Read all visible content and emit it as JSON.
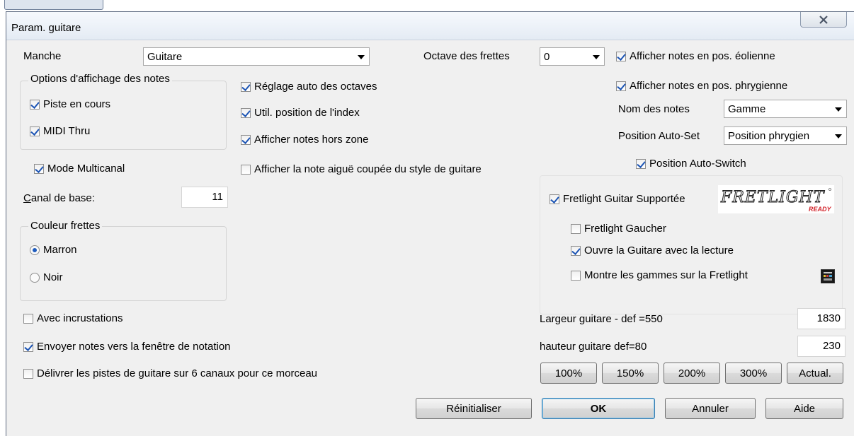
{
  "window": {
    "title": "Param. guitare"
  },
  "manche": {
    "label": "Manche",
    "value": "Guitare"
  },
  "octave": {
    "label": "Octave des frettes",
    "value": "0"
  },
  "right_checks": {
    "aeolian": "Afficher notes en pos. éolienne",
    "phrygian": "Afficher notes en pos. phrygienne"
  },
  "nom_notes": {
    "label": "Nom des notes",
    "value": "Gamme"
  },
  "auto_set": {
    "label": "Position Auto-Set",
    "value": "Position phrygien"
  },
  "auto_switch": "Position Auto-Switch",
  "options_group": {
    "title": "Options d'affichage des notes",
    "piste": "Piste en cours",
    "midi": "MIDI Thru"
  },
  "middle_checks": {
    "reglage": "Réglage auto des octaves",
    "index": "Util. position de l'index",
    "hors_zone": "Afficher notes hors zone",
    "aigue": "Afficher la note aiguë coupée du style de guitare"
  },
  "multicanal": "Mode Multicanal",
  "canal": {
    "label_accel": "C",
    "label_rest": "anal de base:",
    "value": "11"
  },
  "couleur_group": {
    "title": "Couleur frettes",
    "marron": "Marron",
    "noir": "Noir"
  },
  "fretlight": {
    "supported": "Fretlight Guitar Supportée",
    "logo_text": "FRETLIGHT",
    "logo_sub": "READY",
    "gaucher": "Fretlight Gaucher",
    "ouvre": "Ouvre la Guitare avec la lecture",
    "montre": "Montre les gammes sur la Fretlight"
  },
  "bottom_checks": {
    "incrustations": "Avec incrustations",
    "envoyer": "Envoyer notes vers la fenêtre de notation",
    "delivrer": "Délivrer les pistes de guitare sur 6 canaux pour ce morceau"
  },
  "largeur": {
    "label": "Largeur guitare - def =550",
    "value": "1830"
  },
  "hauteur": {
    "label": "hauteur guitare def=80",
    "value": "230"
  },
  "zoom_buttons": [
    "100%",
    "150%",
    "200%",
    "300%",
    "Actual."
  ],
  "buttons": {
    "reset": "Réinitialiser",
    "ok": "OK",
    "cancel": "Annuler",
    "help": "Aide"
  }
}
